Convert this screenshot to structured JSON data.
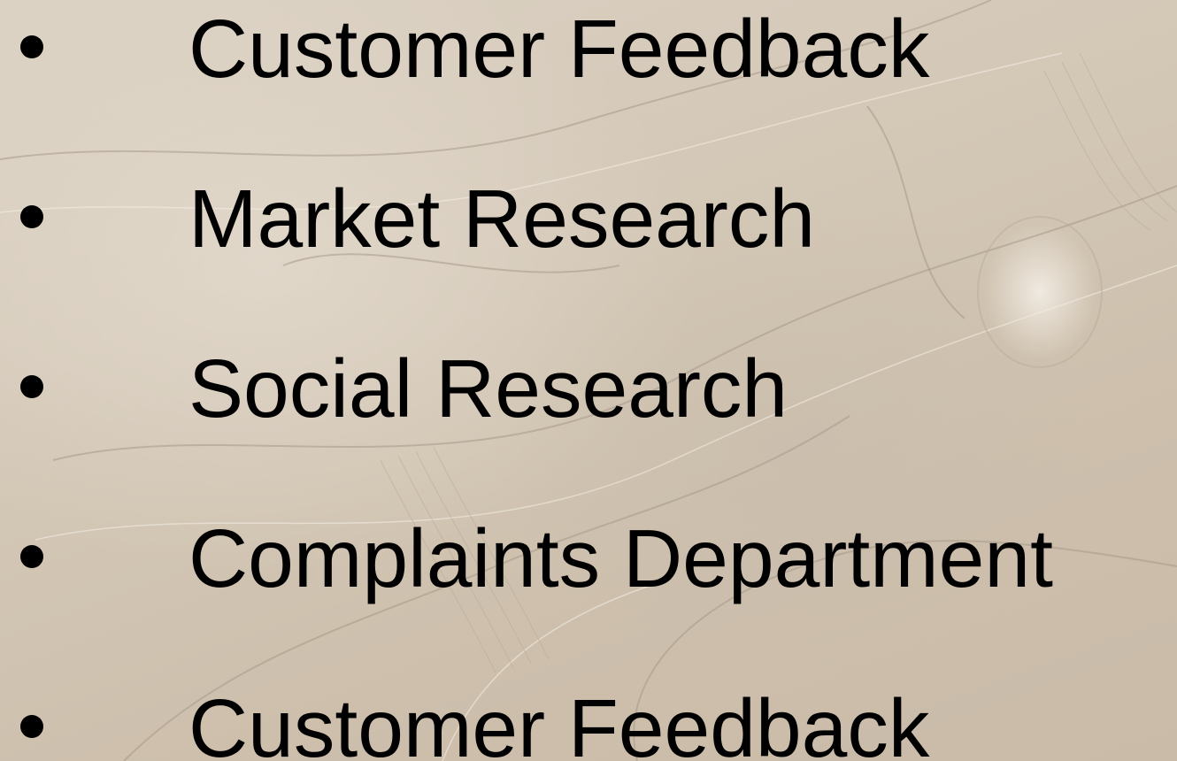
{
  "slide": {
    "background": "parchment-texture",
    "text_color": "#000000",
    "bullets": [
      {
        "label": "Customer Feedback"
      },
      {
        "label": "Market Research"
      },
      {
        "label": "Social Research"
      },
      {
        "label": "Complaints Department"
      },
      {
        "label": "Customer Feedback"
      }
    ]
  }
}
